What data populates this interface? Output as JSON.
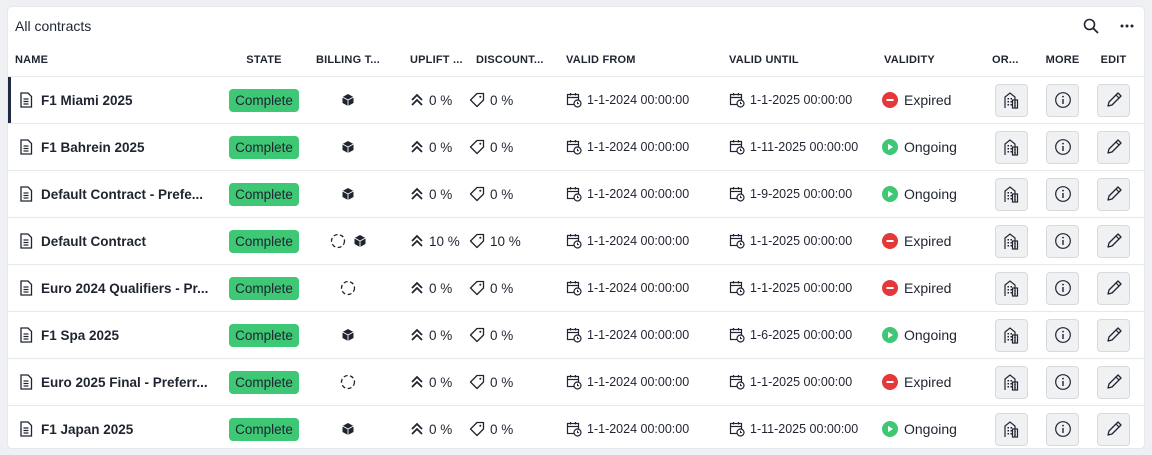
{
  "header": {
    "title": "All contracts",
    "search_icon": "search-icon",
    "more_icon": "more-horizontal-icon"
  },
  "columns": {
    "name": "NAME",
    "state": "STATE",
    "billing": "BILLING T...",
    "uplift": "UPLIFT ...",
    "discount": "DISCOUNT...",
    "valid_from": "VALID FROM",
    "valid_until": "VALID UNTIL",
    "validity": "VALIDITY",
    "org": "OR...",
    "more": "MORE",
    "edit": "EDIT"
  },
  "colors": {
    "complete": "#3ec775",
    "expired": "#e5383b",
    "ongoing": "#3ec775",
    "accent": "#1f2a44"
  },
  "rows": [
    {
      "name": "F1 Miami 2025",
      "state": "Complete",
      "billing": [
        "box"
      ],
      "uplift": "0 %",
      "discount": "0 %",
      "valid_from": "1-1-2024 00:00:00",
      "valid_until": "1-1-2025 00:00:00",
      "validity": "Expired"
    },
    {
      "name": "F1 Bahrein 2025",
      "state": "Complete",
      "billing": [
        "box"
      ],
      "uplift": "0 %",
      "discount": "0 %",
      "valid_from": "1-1-2024 00:00:00",
      "valid_until": "1-11-2025 00:00:00",
      "validity": "Ongoing"
    },
    {
      "name": "Default Contract - Prefe...",
      "state": "Complete",
      "billing": [
        "box"
      ],
      "uplift": "0 %",
      "discount": "0 %",
      "valid_from": "1-1-2024 00:00:00",
      "valid_until": "1-9-2025 00:00:00",
      "validity": "Ongoing"
    },
    {
      "name": "Default Contract",
      "state": "Complete",
      "billing": [
        "cycle",
        "box"
      ],
      "uplift": "10 %",
      "discount": "10 %",
      "valid_from": "1-1-2024 00:00:00",
      "valid_until": "1-1-2025 00:00:00",
      "validity": "Expired"
    },
    {
      "name": "Euro 2024 Qualifiers - Pr...",
      "state": "Complete",
      "billing": [
        "cycle"
      ],
      "uplift": "0 %",
      "discount": "0 %",
      "valid_from": "1-1-2024 00:00:00",
      "valid_until": "1-1-2025 00:00:00",
      "validity": "Expired"
    },
    {
      "name": "F1 Spa 2025",
      "state": "Complete",
      "billing": [
        "box"
      ],
      "uplift": "0 %",
      "discount": "0 %",
      "valid_from": "1-1-2024 00:00:00",
      "valid_until": "1-6-2025 00:00:00",
      "validity": "Ongoing"
    },
    {
      "name": "Euro 2025 Final - Preferr...",
      "state": "Complete",
      "billing": [
        "cycle"
      ],
      "uplift": "0 %",
      "discount": "0 %",
      "valid_from": "1-1-2024 00:00:00",
      "valid_until": "1-1-2025 00:00:00",
      "validity": "Expired"
    },
    {
      "name": "F1 Japan 2025",
      "state": "Complete",
      "billing": [
        "box"
      ],
      "uplift": "0 %",
      "discount": "0 %",
      "valid_from": "1-1-2024 00:00:00",
      "valid_until": "1-11-2025 00:00:00",
      "validity": "Ongoing"
    }
  ]
}
